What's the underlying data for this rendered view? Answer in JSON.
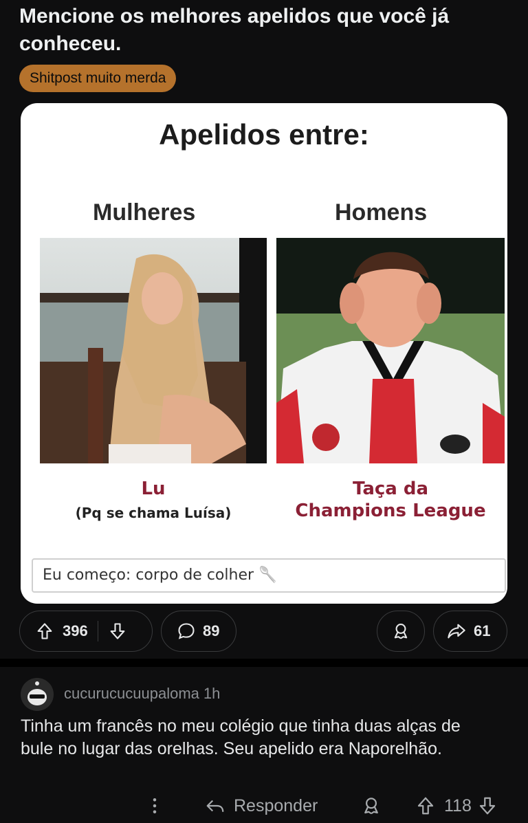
{
  "post": {
    "title": "Mencione os melhores apelidos que você já conheceu.",
    "flair": "Shitpost muito merda"
  },
  "meme": {
    "title": "Apelidos entre:",
    "left_header": "Mulheres",
    "right_header": "Homens",
    "left_nick": "Lu",
    "left_note": "(Pq se chama Luísa)",
    "right_nick_line1": "Taça da",
    "right_nick_line2": "Champions League",
    "comment": "Eu começo: corpo de colher 🥄"
  },
  "actions": {
    "upvotes": "396",
    "comments": "89",
    "shares": "61"
  },
  "comment": {
    "username": "cucurucucuupaloma",
    "time": "1h",
    "text": "Tinha um francês no meu colégio que tinha duas alças de bule no lugar das orelhas. Seu apelido era Naporelhão.",
    "reply_label": "Responder",
    "votes": "118"
  },
  "colors": {
    "background": "#0e0e0f",
    "flair": "#b5722c",
    "nick": "#8b2035"
  },
  "icons": [
    "upvote-icon",
    "downvote-icon",
    "comment-icon",
    "award-icon",
    "share-icon",
    "more-icon",
    "reply-icon"
  ]
}
